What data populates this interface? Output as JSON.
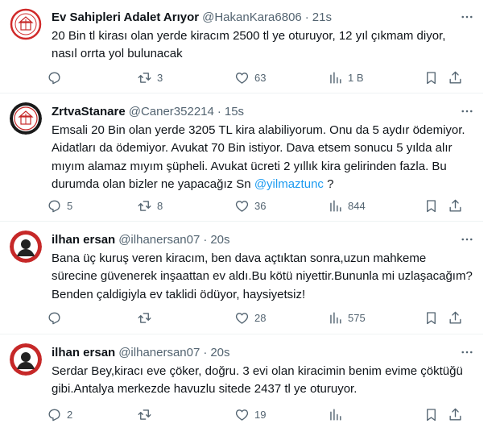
{
  "tweets": [
    {
      "name": "Ev Sahipleri Adalet Arıyor",
      "handle": "@HakanKara6806",
      "time": "21s",
      "text": "20 Bin tl kirası olan yerde kiracım 2500 tl ye oturuyor, 12 yıl çıkmam diyor, nasıl orrta yol bulunacak",
      "replies": "",
      "retweets": "3",
      "likes": "63",
      "views": "1 B"
    },
    {
      "name": "ZrtvaStanare",
      "handle": "@Caner352214",
      "time": "15s",
      "text": "Emsali 20 Bin olan yerde 3205 TL kira alabiliyorum. Onu da 5 aydır ödemiyor. Aidatları da ödemiyor. Avukat 70 Bin istiyor. Dava etsem sonucu 5 yılda alır mıyım alamaz mıyım şüpheli. Avukat ücreti 2 yıllık kira gelirinden fazla. Bu durumda olan bizler ne yapacağız Sn ",
      "mention": "@yilmaztunc",
      "text_after": " ?",
      "replies": "5",
      "retweets": "8",
      "likes": "36",
      "views": "844"
    },
    {
      "name": "ilhan ersan",
      "handle": "@ilhanersan07",
      "time": "20s",
      "text": "Bana üç kuruş veren kiracım, ben dava açtıktan sonra,uzun mahkeme sürecine güvenerek inşaattan ev aldı.Bu kötü niyettir.Bununla mi uzlaşacağım?Benden çaldigiyla ev taklidi ödüyor, haysiyetsiz!",
      "replies": "",
      "retweets": "",
      "likes": "28",
      "views": "575"
    },
    {
      "name": "ilhan ersan",
      "handle": "@ilhanersan07",
      "time": "20s",
      "text": "Serdar Bey,kiracı eve çöker, doğru. 3 evi olan kiracimin benim evime çöktüğü gibi.Antalya merkezde havuzlu sitede 2437 tl ye oturuyor.",
      "replies": "2",
      "retweets": "",
      "likes": "19",
      "views": ""
    }
  ],
  "colors": {
    "text": "#0f1419",
    "secondary": "#536471",
    "link": "#1d9bf0",
    "divider": "#eff3f4"
  },
  "icons": [
    "more-icon",
    "reply-icon",
    "retweet-icon",
    "like-icon",
    "views-icon",
    "bookmark-icon",
    "share-icon"
  ]
}
